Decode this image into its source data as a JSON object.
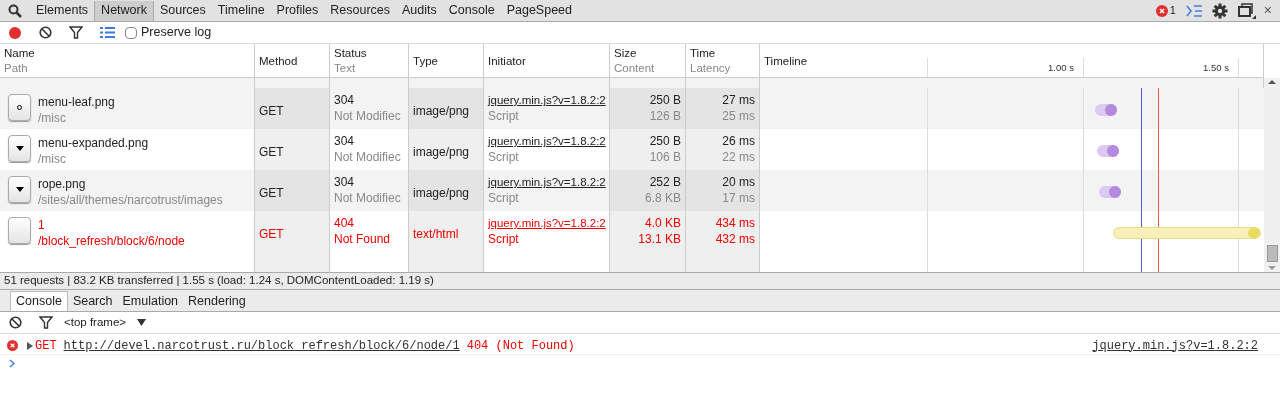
{
  "panel_tabs": [
    {
      "label": "Elements",
      "selected": false
    },
    {
      "label": "Network",
      "selected": true
    },
    {
      "label": "Sources",
      "selected": false
    },
    {
      "label": "Timeline",
      "selected": false
    },
    {
      "label": "Profiles",
      "selected": false
    },
    {
      "label": "Resources",
      "selected": false
    },
    {
      "label": "Audits",
      "selected": false
    },
    {
      "label": "Console",
      "selected": false
    },
    {
      "label": "PageSpeed",
      "selected": false
    }
  ],
  "error_count": "1",
  "close_glyph": "×",
  "network_toolbar": {
    "recording": true,
    "preserve_log": {
      "label": "Preserve log",
      "checked": false
    }
  },
  "columns": [
    {
      "title": "Name",
      "subtitle": "Path"
    },
    {
      "title": "Method"
    },
    {
      "title": "Status",
      "subtitle": "Text"
    },
    {
      "title": "Type"
    },
    {
      "title": "Initiator"
    },
    {
      "title": "Size",
      "subtitle": "Content"
    },
    {
      "title": "Time",
      "subtitle": "Latency"
    },
    {
      "title": "Timeline"
    }
  ],
  "timeline_ticks": [
    "1.00 s",
    "1.50 s"
  ],
  "rows": [
    {
      "name": "menu-leaf.png",
      "path": "/misc",
      "method": "GET",
      "status": "304",
      "status_text": "Not Modifiec",
      "type": "image/png",
      "initiator": "jquery.min.js?v=1.8.2:2",
      "initiator_type": "Script",
      "size": "250 B",
      "content": "126 B",
      "time": "27 ms",
      "latency": "25 ms",
      "error": false
    },
    {
      "name": "menu-expanded.png",
      "path": "/misc",
      "method": "GET",
      "status": "304",
      "status_text": "Not Modifiec",
      "type": "image/png",
      "initiator": "jquery.min.js?v=1.8.2:2",
      "initiator_type": "Script",
      "size": "250 B",
      "content": "106 B",
      "time": "26 ms",
      "latency": "22 ms",
      "error": false
    },
    {
      "name": "rope.png",
      "path": "/sites/all/themes/narcotrust/images",
      "method": "GET",
      "status": "304",
      "status_text": "Not Modifiec",
      "type": "image/png",
      "initiator": "jquery.min.js?v=1.8.2:2",
      "initiator_type": "Script",
      "size": "252 B",
      "content": "6.8 KB",
      "time": "20 ms",
      "latency": "17 ms",
      "error": false
    },
    {
      "name": "1",
      "path": "/block_refresh/block/6/node",
      "method": "GET",
      "status": "404",
      "status_text": "Not Found",
      "type": "text/html",
      "initiator": "jquery.min.js?v=1.8.2:2",
      "initiator_type": "Script",
      "size": "4.0 KB",
      "content": "13.1 KB",
      "time": "434 ms",
      "latency": "432 ms",
      "error": true
    }
  ],
  "summary": "51 requests | 83.2 KB transferred | 1.55 s (load: 1.24 s, DOMContentLoaded: 1.19 s)",
  "drawer_tabs": [
    {
      "label": "Console",
      "selected": true
    },
    {
      "label": "Search",
      "selected": false
    },
    {
      "label": "Emulation",
      "selected": false
    },
    {
      "label": "Rendering",
      "selected": false
    }
  ],
  "console": {
    "context": "<top frame>",
    "messages": [
      {
        "error": true,
        "method": "GET",
        "url": "http://devel.narcotrust.ru/block_refresh/block/6/node/1",
        "status": "404 (Not Found)",
        "source": "jquery.min.js?v=1.8.2:2"
      }
    ]
  }
}
